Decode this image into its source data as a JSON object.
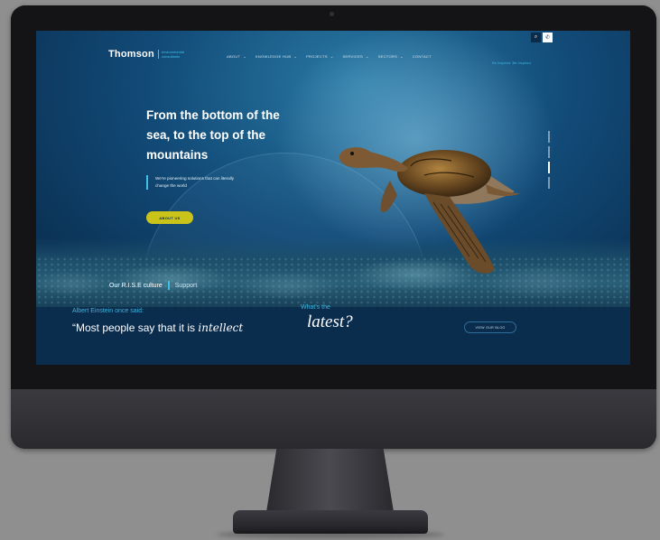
{
  "site": {
    "logo_word": "Thomson",
    "logo_sub": "environmental consultants",
    "tagline": "Be Inspired. Be Inspired."
  },
  "nav": {
    "items": [
      {
        "label": "ABOUT",
        "has_menu": true
      },
      {
        "label": "KNOWLEDGE HUB",
        "has_menu": true
      },
      {
        "label": "PROJECTS",
        "has_menu": true
      },
      {
        "label": "SERVICES",
        "has_menu": true
      },
      {
        "label": "SECTORS",
        "has_menu": true
      },
      {
        "label": "CONTACT",
        "has_menu": false
      }
    ],
    "chevron": "⌄",
    "search_glyph": "⌕",
    "phone_glyph": "✆"
  },
  "hero": {
    "headline": "From the bottom of the sea, to the top of the mountains",
    "intro": "We're pioneering solutions that can literally change the world",
    "cta_label": "ABOUT US",
    "culture_label": "Our R.I.S.E culture",
    "support_label": "Support",
    "slides_total": 4,
    "slide_active": 3
  },
  "lower": {
    "einstein_label": "Albert Einstein once said:",
    "quote_start": "“Most people say that it is ",
    "quote_italic": "intellect",
    "whats_label": "What's the",
    "latest_label": "latest?",
    "blog_button": "VIEW OUR BLOG"
  },
  "colors": {
    "accent": "#3fc0e8",
    "cta": "#c9c31a",
    "navy": "#0a2c4d"
  },
  "icons": [
    "search-icon",
    "phone-icon",
    "chevron-down-icon",
    "turtle-illustration"
  ]
}
